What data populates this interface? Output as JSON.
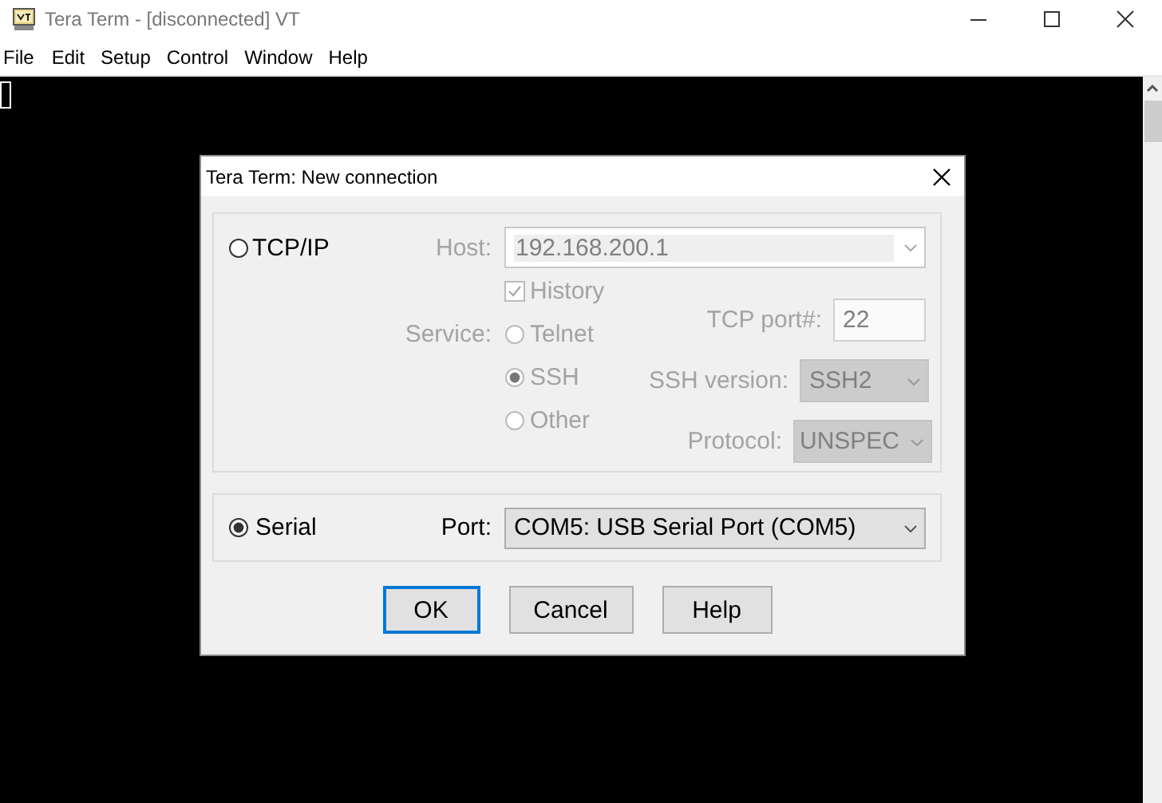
{
  "window": {
    "title": "Tera Term - [disconnected] VT"
  },
  "menu": [
    "File",
    "Edit",
    "Setup",
    "Control",
    "Window",
    "Help"
  ],
  "dialog": {
    "title": "Tera Term: New connection",
    "tcpip": {
      "label": "TCP/IP",
      "selected": false,
      "disabled": true,
      "host": {
        "label": "Host:",
        "value": "192.168.200.1"
      },
      "history": {
        "label": "History",
        "checked": true
      },
      "service": {
        "label": "Service:",
        "options": [
          {
            "label": "Telnet",
            "selected": false
          },
          {
            "label": "SSH",
            "selected": true
          },
          {
            "label": "Other",
            "selected": false
          }
        ]
      },
      "tcp_port": {
        "label": "TCP port#:",
        "value": "22"
      },
      "ssh_version": {
        "label": "SSH version:",
        "value": "SSH2"
      },
      "protocol": {
        "label": "Protocol:",
        "value": "UNSPEC"
      }
    },
    "serial": {
      "label": "Serial",
      "selected": true,
      "port": {
        "label": "Port:",
        "value": "COM5: USB Serial Port (COM5)"
      }
    },
    "buttons": [
      {
        "label": "OK",
        "default": true
      },
      {
        "label": "Cancel",
        "default": false
      },
      {
        "label": "Help",
        "default": false
      }
    ]
  }
}
